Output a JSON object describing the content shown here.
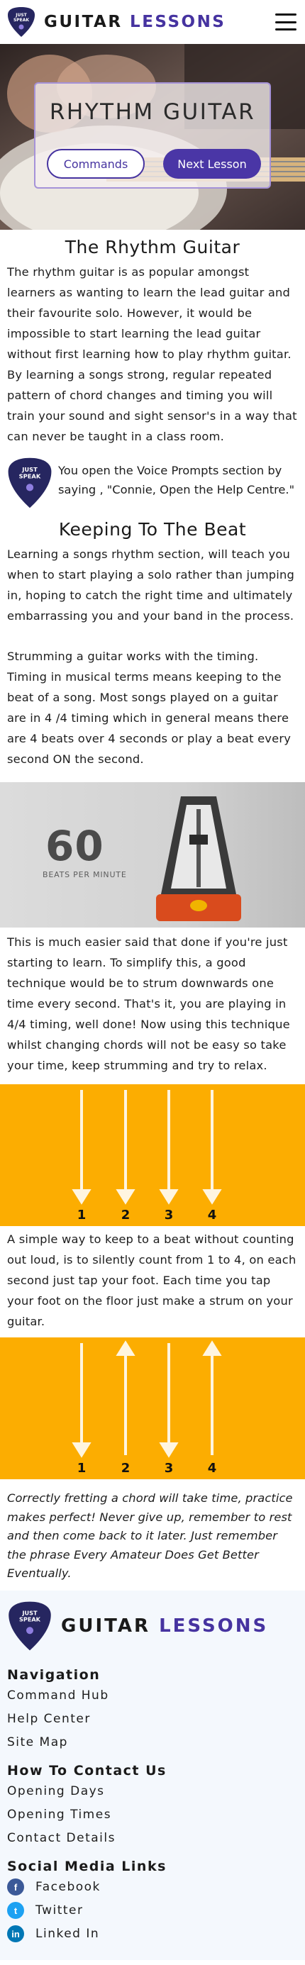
{
  "header": {
    "logo_text": [
      "JUST",
      "SPEAK"
    ],
    "brand_primary": "GUITAR",
    "brand_accent": "LESSONS",
    "accent_color": "#4633a0",
    "menu_icon": "hamburger-menu-icon"
  },
  "hero": {
    "title": "RHYTHM GUITAR",
    "commands_label": "Commands",
    "next_label": "Next Lesson"
  },
  "intro": {
    "title": "The Rhythm Guitar",
    "paragraph": "The rhythm guitar is as popular amongst learners as wanting to learn the lead guitar and their favourite solo. However, it would be impossible to start learning the lead guitar without first learning how to play rhythm guitar. By learning a songs strong, regular repeated pattern of chord changes and timing you will train your sound and sight sensor's in a way that can never be taught in a class room."
  },
  "voice_prompt": {
    "text": "You open the Voice Prompts section by saying , \"Connie, Open the Help Centre.\""
  },
  "beat": {
    "title": "Keeping To The Beat",
    "paragraph1": "Learning a songs rhythm section, will teach you when to start playing a solo rather than jumping in, hoping to catch the right time and ultimately embarrassing you and your band in the process.",
    "paragraph2": "Strumming a guitar works with the timing. Timing in musical terms means keeping to the beat of a song. Most songs played on a guitar are in 4 /4 timing which in general means there are 4 beats over 4 seconds or play a beat every second ON the second."
  },
  "metronome": {
    "bpm": "60",
    "label": "BEATS PER MINUTE"
  },
  "strum": {
    "paragraph1": "This is much easier said that done if you're just starting to learn. To simplify this, a good technique would be to strum downwards one time every second. That's it, you are playing in 4/4 timing, well done! Now using this technique whilst changing chords will not be easy so take your time, keep strumming and try to relax.",
    "diagram1_numbers": [
      "1",
      "2",
      "3",
      "4"
    ],
    "diagram1_directions": [
      "down",
      "down",
      "down",
      "down"
    ],
    "paragraph2": "A simple way to keep to a beat without counting out loud, is to silently count from 1 to 4, on each second just tap your foot. Each time you tap your foot on the floor just make a strum on your guitar.",
    "diagram2_numbers": [
      "1",
      "2",
      "3",
      "4"
    ],
    "diagram2_directions": [
      "down",
      "up",
      "down",
      "up"
    ],
    "panel_color": "#fcad01"
  },
  "closing": {
    "text": "Correctly fretting a chord will take time, practice makes perfect! Never give up, remember to rest and then come back to it later. Just remember the phrase Every Amateur Does Get Better Eventually."
  },
  "footer": {
    "brand_primary": "GUITAR",
    "brand_accent": "LESSONS",
    "nav_heading": "Navigation",
    "nav_links": [
      "Command Hub",
      "Help Center",
      "Site Map"
    ],
    "contact_heading": "How To Contact Us",
    "contact_links": [
      "Opening Days",
      "Opening Times",
      "Contact Details"
    ],
    "social_heading": "Social Media Links",
    "social": [
      {
        "label": "Facebook",
        "icon": "facebook-icon",
        "color": "#3b5998"
      },
      {
        "label": "Twitter",
        "icon": "twitter-icon",
        "color": "#1da1f2"
      },
      {
        "label": "Linked In",
        "icon": "linkedin-icon",
        "color": "#0077b5"
      }
    ]
  }
}
